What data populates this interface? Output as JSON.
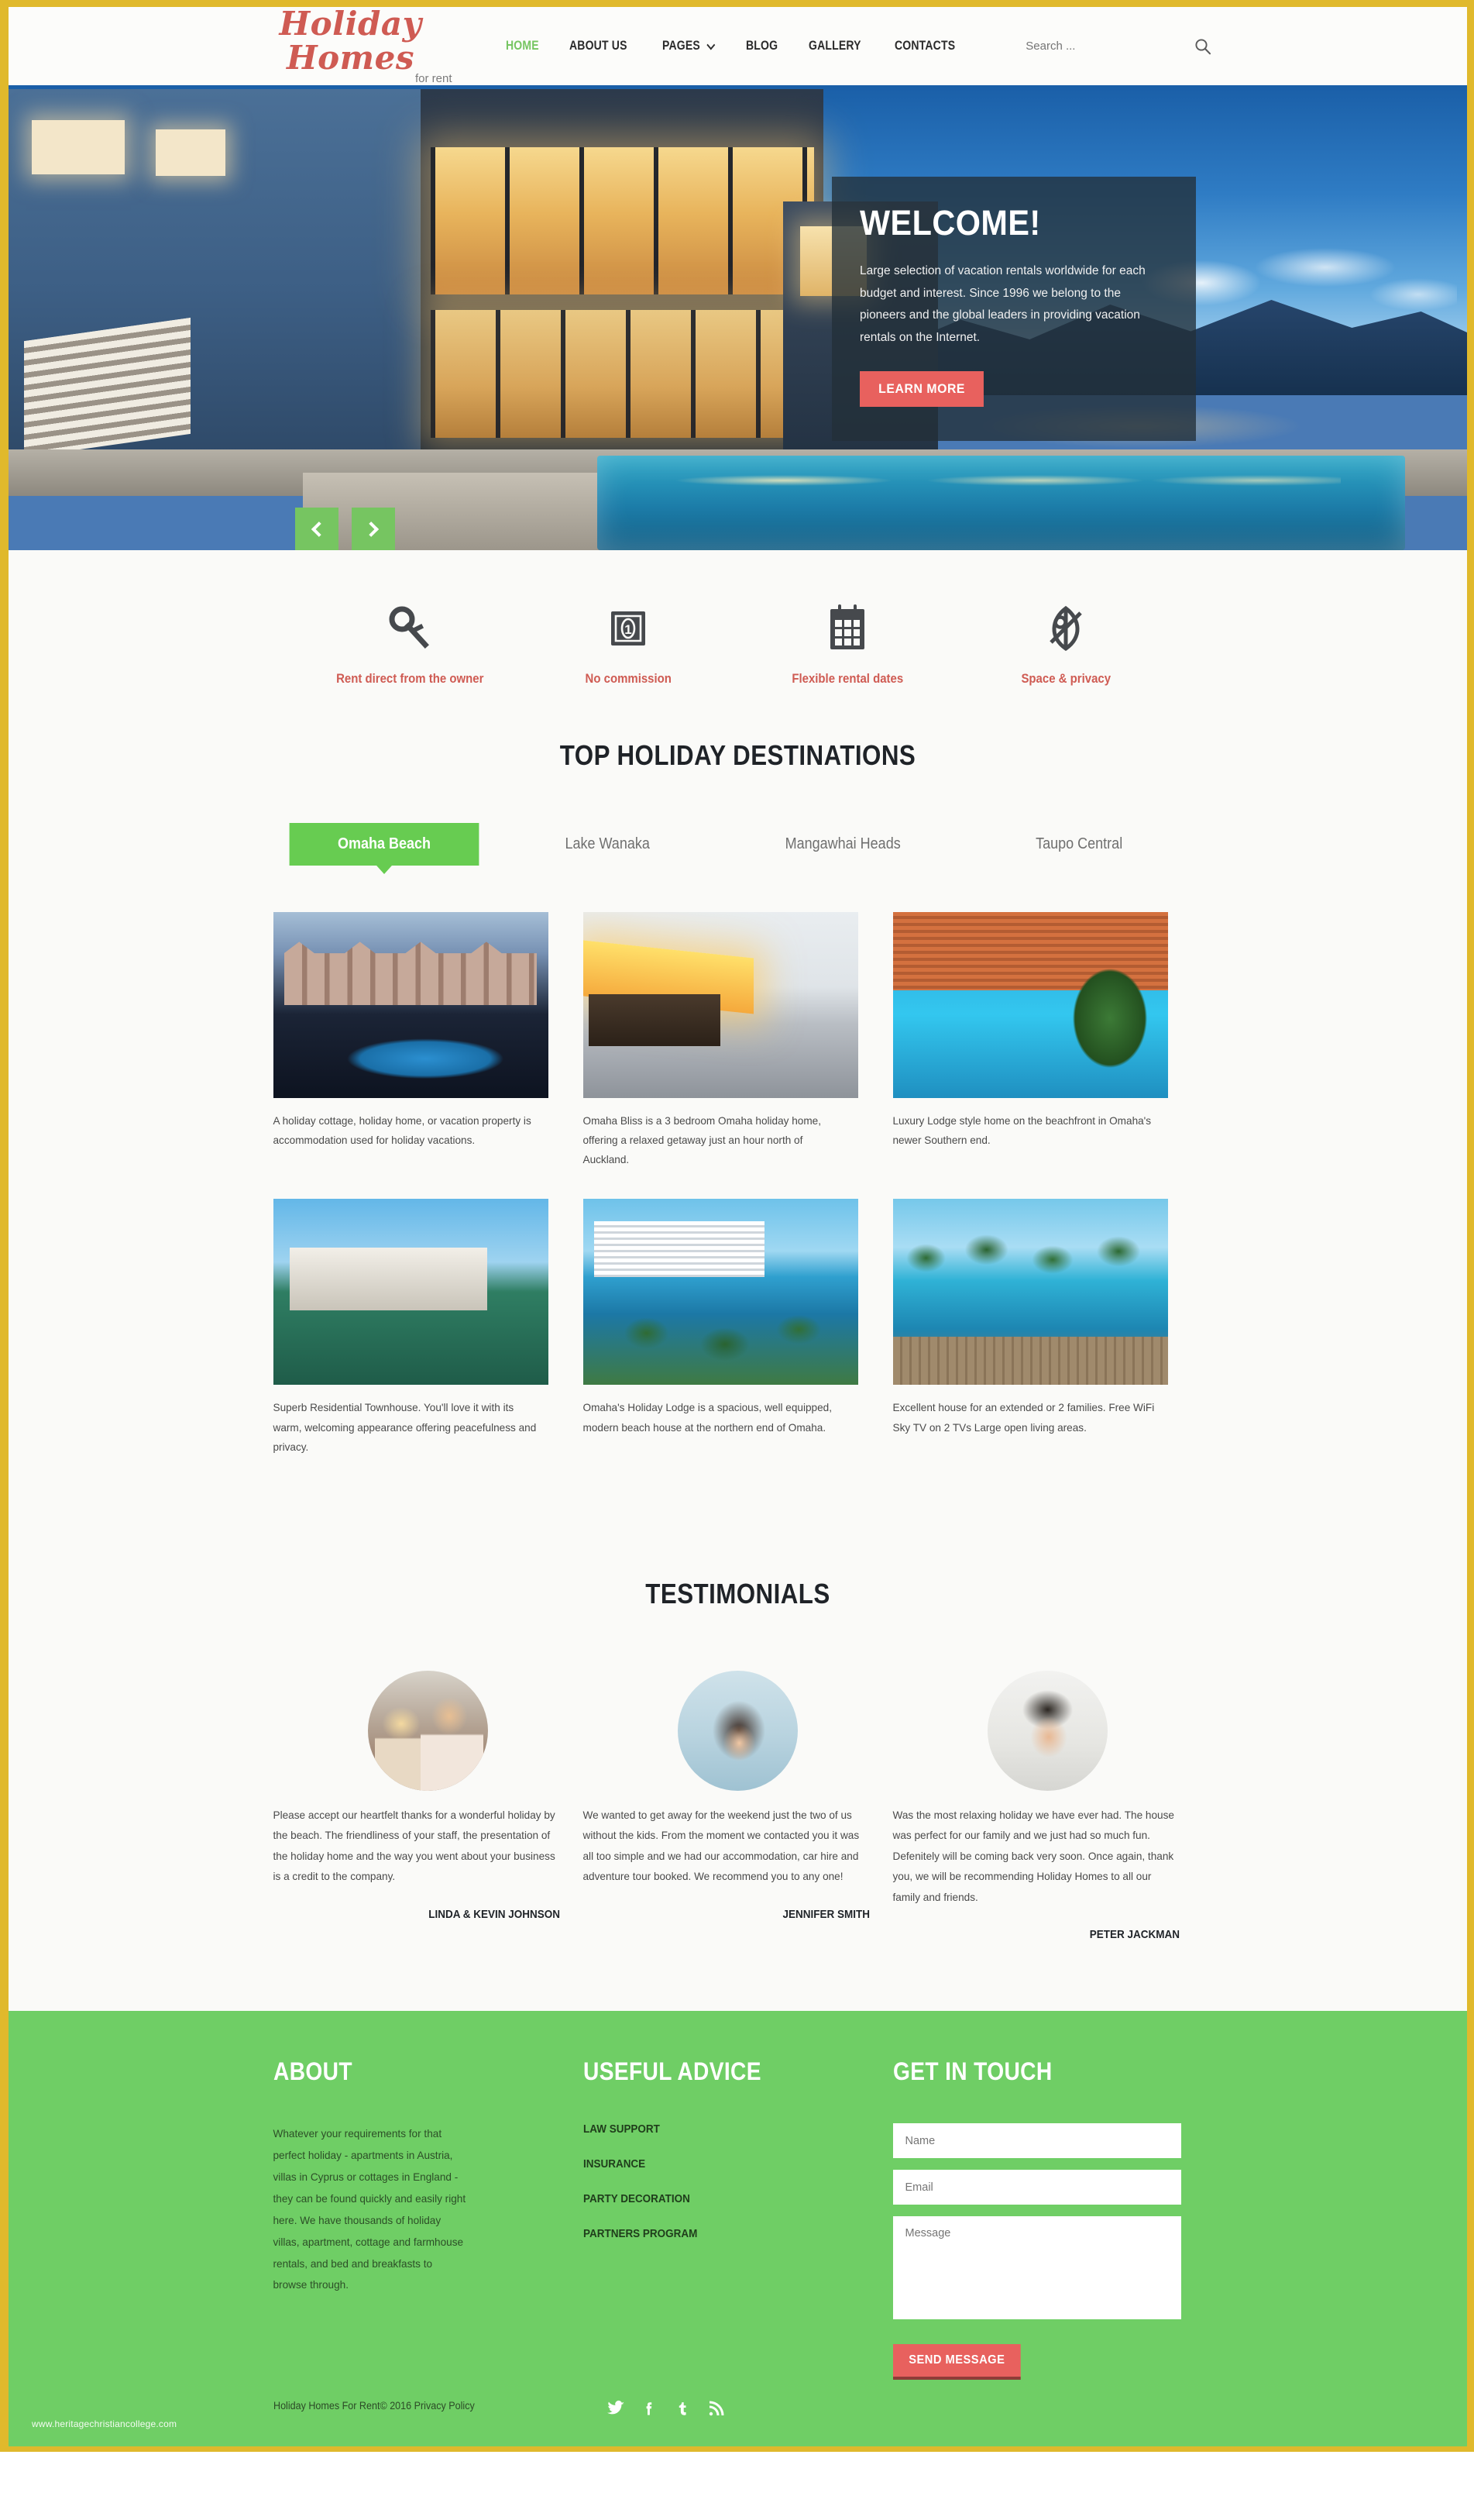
{
  "header": {
    "logo_main": "Holiday Homes",
    "logo_sub": "for rent",
    "nav": [
      {
        "label": "HOME",
        "active": true,
        "dropdown": false
      },
      {
        "label": "ABOUT US",
        "active": false,
        "dropdown": false
      },
      {
        "label": "PAGES",
        "active": false,
        "dropdown": true
      },
      {
        "label": "BLOG",
        "active": false,
        "dropdown": false
      },
      {
        "label": "GALLERY",
        "active": false,
        "dropdown": false
      },
      {
        "label": "CONTACTS",
        "active": false,
        "dropdown": false
      }
    ],
    "search_placeholder": "Search ...",
    "search_value": "",
    "search_icon": "search-icon"
  },
  "hero": {
    "title": "WELCOME!",
    "text": "Large selection of vacation rentals worldwide for each budget and interest. Since 1996 we belong to the pioneers and the global leaders in providing vacation rentals on the Internet.",
    "button": "LEARN MORE",
    "prev_icon": "chevron-left-icon",
    "next_icon": "chevron-right-icon"
  },
  "features": [
    {
      "icon": "key-icon",
      "label": "Rent direct from the owner"
    },
    {
      "icon": "banknote-icon",
      "label": "No commission"
    },
    {
      "icon": "calendar-icon",
      "label": "Flexible rental dates"
    },
    {
      "icon": "leaf-privacy-icon",
      "label": "Space & privacy"
    }
  ],
  "destinations": {
    "title": "TOP HOLIDAY DESTINATIONS",
    "tabs": [
      {
        "label": "Omaha Beach",
        "active": true
      },
      {
        "label": "Lake Wanaka",
        "active": false
      },
      {
        "label": "Mangawhai Heads",
        "active": false
      },
      {
        "label": "Taupo Central",
        "active": false
      }
    ],
    "cards": [
      {
        "caption": "A holiday cottage, holiday home, or vacation property is accommodation used for holiday vacations."
      },
      {
        "caption": "Omaha Bliss is a 3 bedroom Omaha holiday home, offering a relaxed getaway just an hour north of Auckland."
      },
      {
        "caption": "Luxury Lodge style home on the beachfront in Omaha's newer Southern end."
      },
      {
        "caption": "Superb Residential Townhouse. You'll love it with its warm, welcoming appearance offering peacefulness and privacy."
      },
      {
        "caption": "Omaha's Holiday Lodge is a spacious, well equipped, modern beach house at the northern end of Omaha."
      },
      {
        "caption": "Excellent house for an extended or 2 families. Free WiFi Sky TV on 2 TVs Large open living areas."
      }
    ]
  },
  "testimonials": {
    "title": "TESTIMONIALS",
    "items": [
      {
        "quote": "Please accept our heartfelt thanks for a wonderful holiday by the beach. The friendliness of your staff, the presentation of the holiday home and the way you went about your business is a credit to the company.",
        "author": "LINDA & KEVIN JOHNSON"
      },
      {
        "quote": "We wanted to get away for the weekend just the two of us without the kids. From the moment we contacted you it was all too simple and we had our accommodation, car hire and adventure tour booked. We recommend you to any one!",
        "author": "JENNIFER SMITH"
      },
      {
        "quote": "Was the most relaxing holiday we have ever had. The house was perfect for our family and we just had so much fun. Defenitely will be coming back very soon. Once again, thank you, we will be recommending Holiday Homes to all our family and friends.",
        "author": "PETER JACKMAN"
      }
    ]
  },
  "footer": {
    "about_head": "ABOUT",
    "about_text": "Whatever your requirements for that perfect holiday - apartments in Austria, villas in Cyprus or cottages in England - they can be found quickly and easily right here. We have thousands of holiday villas, apartment, cottage and farmhouse rentals, and bed and breakfasts to browse through.",
    "advice_head": "USEFUL ADVICE",
    "advice_links": [
      "LAW SUPPORT",
      "INSURANCE",
      "PARTY DECORATION",
      "PARTNERS PROGRAM"
    ],
    "touch_head": "GET IN TOUCH",
    "name_placeholder": "Name",
    "name_value": "",
    "email_placeholder": "Email",
    "email_value": "",
    "message_placeholder": "Message",
    "message_value": "",
    "send_label": "SEND MESSAGE",
    "copyright": "Holiday Homes For Rent© 2016 Privacy Policy",
    "socials": [
      {
        "name": "twitter-icon",
        "glyph": "t"
      },
      {
        "name": "facebook-icon",
        "glyph": "f"
      },
      {
        "name": "tumblr-icon",
        "glyph": "t"
      },
      {
        "name": "rss-icon",
        "glyph": "r"
      }
    ],
    "watermark": "www.heritagechristiancollege.com"
  },
  "colors": {
    "brand_red": "#cf5b53",
    "accent_green": "#6fce65",
    "tab_green": "#67cc51",
    "button_red": "#e8615e",
    "border_gold": "#e0b92c"
  }
}
